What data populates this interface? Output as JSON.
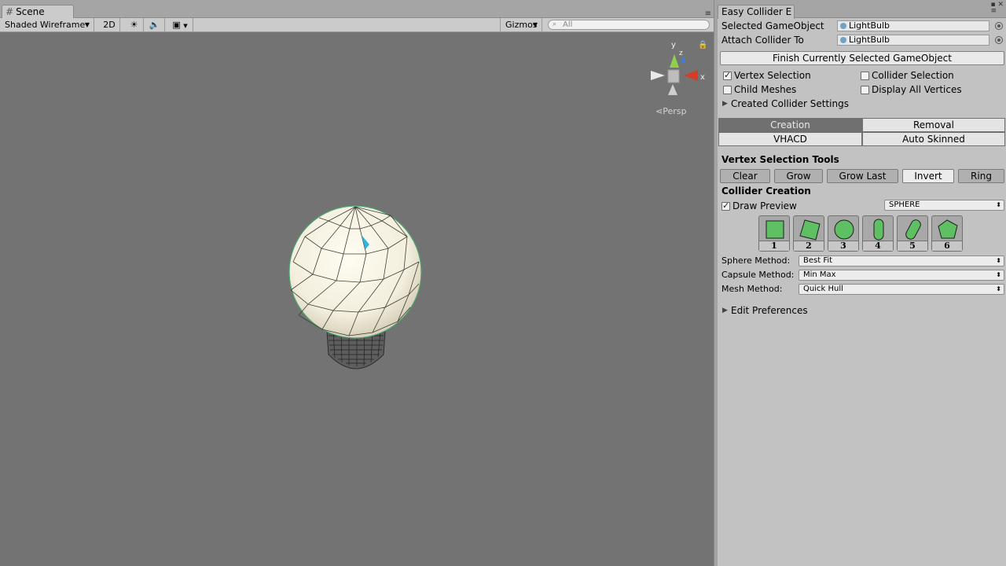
{
  "scene": {
    "tab_label": "Scene",
    "toolbar": {
      "draw_mode": "Shaded Wireframe",
      "mode_2d": "2D",
      "gizmos": "Gizmos",
      "search_placeholder": "All"
    },
    "view_label": "Persp",
    "axes": {
      "x": "x",
      "y": "y",
      "z": "z"
    }
  },
  "inspector": {
    "tab_label": "Easy Collider E",
    "selected_gameobject_label": "Selected GameObject",
    "selected_gameobject_value": "LightBulb",
    "attach_collider_label": "Attach Collider To",
    "attach_collider_value": "LightBulb",
    "finish_button": "Finish Currently Selected GameObject",
    "checkboxes": {
      "vertex_selection": {
        "label": "Vertex Selection",
        "checked": true
      },
      "collider_selection": {
        "label": "Collider Selection",
        "checked": false
      },
      "child_meshes": {
        "label": "Child Meshes",
        "checked": false
      },
      "display_all_vertices": {
        "label": "Display All Vertices",
        "checked": false
      }
    },
    "created_collider_settings": "Created Collider Settings",
    "mode_tabs": [
      "Creation",
      "Removal",
      "VHACD",
      "Auto Skinned"
    ],
    "active_mode": "Creation",
    "vertex_tools_title": "Vertex Selection Tools",
    "vertex_tools": [
      "Clear",
      "Grow",
      "Grow Last",
      "Invert",
      "Ring"
    ],
    "collider_creation_title": "Collider Creation",
    "draw_preview": {
      "label": "Draw Preview",
      "checked": true
    },
    "preview_type": "SPHERE",
    "shape_buttons": [
      "1",
      "2",
      "3",
      "4",
      "5",
      "6"
    ],
    "shape_icons": [
      "box-collider-icon",
      "rotated-box-collider-icon",
      "sphere-collider-icon",
      "capsule-collider-icon",
      "rotated-capsule-collider-icon",
      "convex-mesh-collider-icon"
    ],
    "sphere_method_label": "Sphere Method:",
    "sphere_method_value": "Best Fit",
    "capsule_method_label": "Capsule Method:",
    "capsule_method_value": "Min Max",
    "mesh_method_label": "Mesh Method:",
    "mesh_method_value": "Quick Hull",
    "edit_preferences": "Edit Preferences"
  },
  "colors": {
    "viewport_bg": "#737373",
    "shape_icon_fill": "#5fbf63",
    "active_tab_bg": "#707070",
    "axis_x": "#d63c2a",
    "axis_y": "#8fd14f",
    "axis_z": "#3b7ee0"
  }
}
